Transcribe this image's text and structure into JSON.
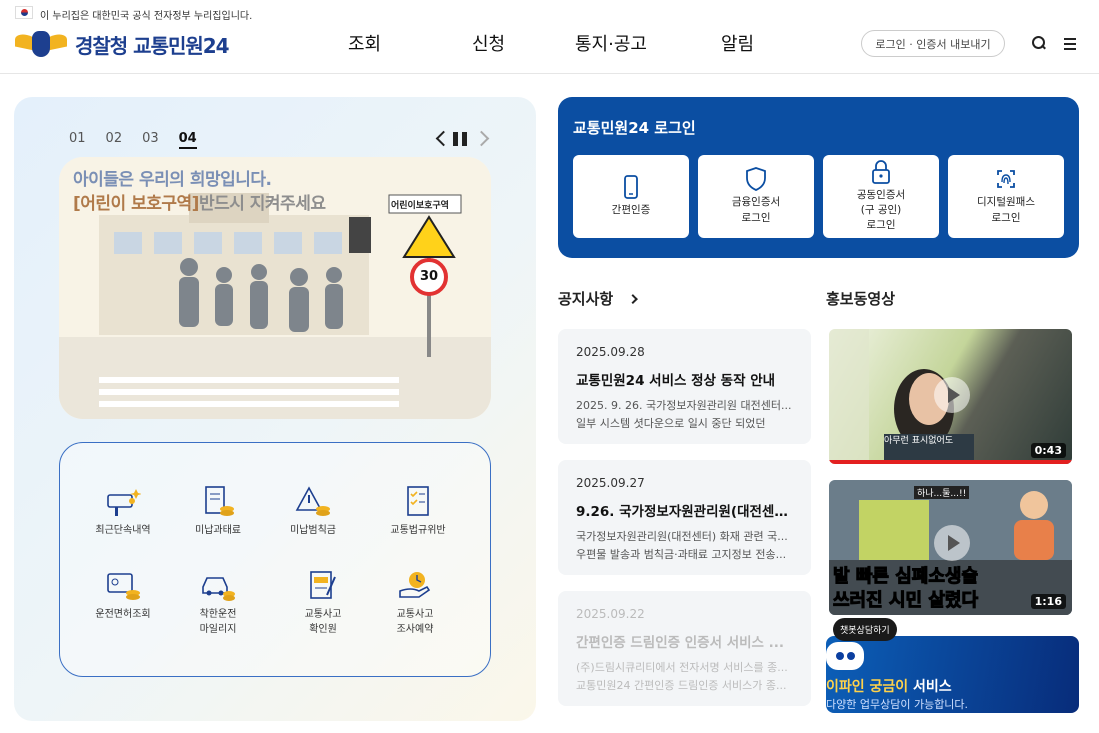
{
  "top": {
    "notice": "이 누리집은 대한민국 공식 전자정부 누리집입니다."
  },
  "header": {
    "logo": "경찰청 교통민원24",
    "nav": [
      "조회",
      "신청",
      "통지·공고",
      "알림"
    ],
    "login_pill": "로그인 · 인증서 내보내기"
  },
  "slider": {
    "numbers": [
      "01",
      "02",
      "03",
      "04"
    ],
    "active": "04",
    "banner_line1": "아이들은 우리의 희망입니다.",
    "banner_line2_hl": "[어린이 보호구역]",
    "banner_line2": "반드시 지켜주세요",
    "sign_label": "어린이보호구역",
    "speed": "30"
  },
  "services": [
    {
      "label": "최근단속내역",
      "icon": "camera-icon"
    },
    {
      "label": "미납과태료",
      "icon": "receipt-coin-icon"
    },
    {
      "label": "미납범칙금",
      "icon": "warning-coin-icon"
    },
    {
      "label": "교통법규위반",
      "icon": "checklist-icon"
    },
    {
      "label": "운전면허조회",
      "icon": "license-coin-icon"
    },
    {
      "label": "착한운전\n마일리지",
      "icon": "car-coin-icon"
    },
    {
      "label": "교통사고\n확인원",
      "icon": "document-pen-icon"
    },
    {
      "label": "교통사고\n조사예약",
      "icon": "hand-clock-icon"
    }
  ],
  "login": {
    "title": "교통민원24 로그인",
    "methods": [
      {
        "label": "간편인증",
        "icon": "phone-icon"
      },
      {
        "label": "금융인증서\n로그인",
        "icon": "shield-icon"
      },
      {
        "label": "공동인증서\n(구 공인)\n로그인",
        "icon": "lock-icon"
      },
      {
        "label": "디지털원패스\n로그인",
        "icon": "fingerprint-icon"
      }
    ]
  },
  "notices": {
    "title": "공지사항",
    "items": [
      {
        "date": "2025.09.28",
        "title": "교통민원24 서비스 정상 동작 안내",
        "body": [
          "2025. 9. 26. 국가정보자원관리원 대전센터...",
          "일부 시스템 셧다운으로 일시 중단 되었던"
        ]
      },
      {
        "date": "2025.09.27",
        "title": "9.26. 국가정보자원관리원(대전센터...",
        "body": [
          "국가정보자원관리원(대전센터) 화재 관련 국...",
          "우편물 발송과 범칙금·과태료 고지정보 전송..."
        ]
      },
      {
        "date": "2025.09.22",
        "title": "간편인증 드림인증 인증서 서비스 ...",
        "body": [
          "(주)드림시큐리티에서 전자서명 서비스를 종...",
          "교통민원24 간편인증 드림인증 서비스가 종..."
        ]
      }
    ]
  },
  "videos": {
    "title": "홍보동영상",
    "items": [
      {
        "duration": "0:43",
        "caption": "아무런 표시없어도"
      },
      {
        "duration": "1:16",
        "caption_top": "하나...둘...!!",
        "caption1": "발 빠른 심폐소생술",
        "caption2": "쓰러진 시민 살렸다"
      }
    ]
  },
  "chat": {
    "tooltip": "챗봇상담하기",
    "name": "이파인 궁금이",
    "suffix": " 서비스",
    "desc": "다양한 업무상담이 가능합니다."
  }
}
